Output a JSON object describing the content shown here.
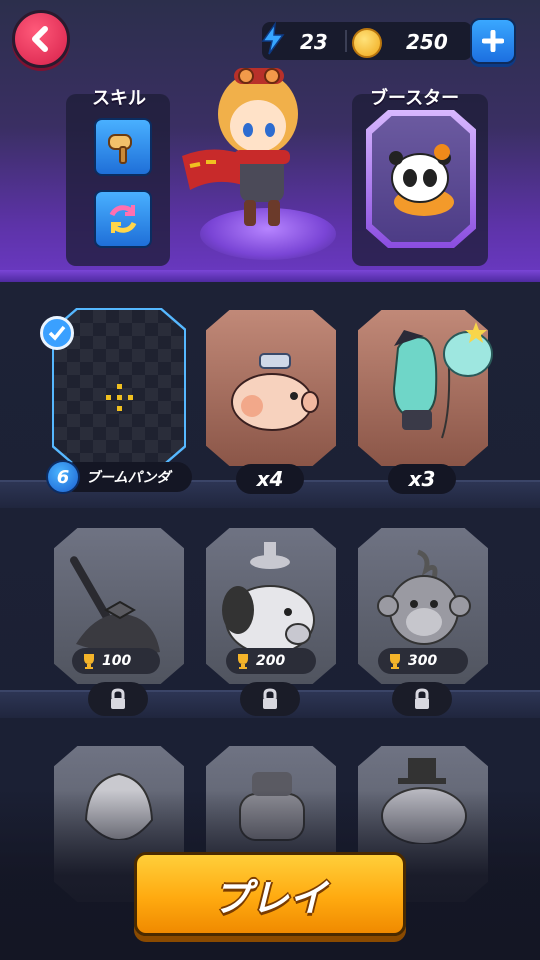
{
  "header": {
    "energy": "23",
    "coins": "250"
  },
  "loadout": {
    "skill_label": "スキル",
    "booster_label": "ブースター"
  },
  "slots": [
    {
      "name": "ブームパンダ",
      "level": "6"
    },
    {
      "count": "x4"
    },
    {
      "count": "x3"
    }
  ],
  "locked": [
    {
      "trophy": "100"
    },
    {
      "trophy": "200"
    },
    {
      "trophy": "300"
    }
  ],
  "play_label": "プレイ",
  "colors": {
    "accent_purple": "#6b39c4",
    "play_orange": "#ffaa10",
    "back_red": "#d6204a",
    "blue": "#1c6fe0"
  }
}
